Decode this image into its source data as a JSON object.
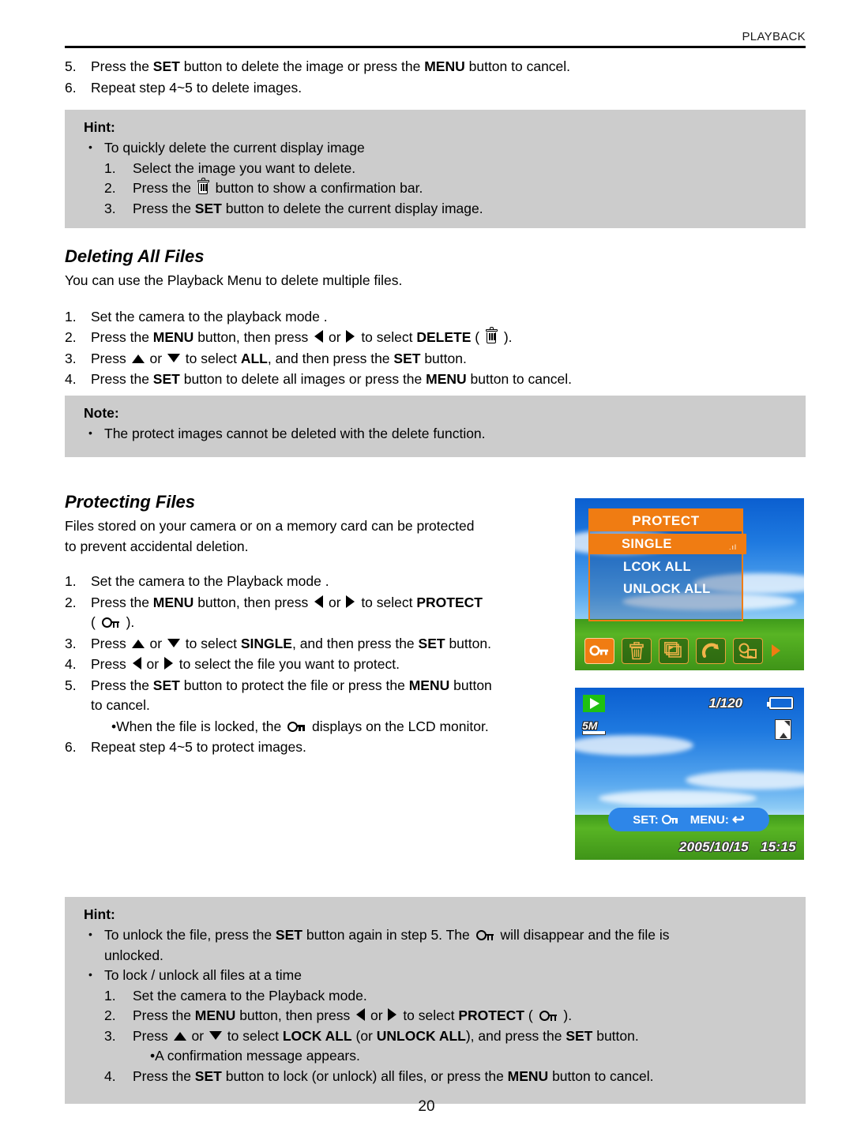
{
  "header": {
    "section_label": "PLAYBACK"
  },
  "delete_steps_continued": [
    {
      "num": "5.",
      "pre": "Press the ",
      "b1": "SET",
      "mid": " button to delete the image or press the ",
      "b2": "MENU",
      "post": " button to cancel."
    },
    {
      "num": "6.",
      "pre": "Repeat step 4~5 to delete images.",
      "b1": "",
      "mid": "",
      "b2": "",
      "post": ""
    }
  ],
  "hint_delete": {
    "title": "Hint:",
    "bullet": "To quickly delete the current display image",
    "steps": [
      {
        "num": "1.",
        "pre": "Select the image you want to delete.",
        "b1": "",
        "post": ""
      },
      {
        "num": "2.",
        "pre": "Press the ",
        "icon": "trash-icon",
        "post": " button to show a confirmation bar."
      },
      {
        "num": "3.",
        "pre": "Press the ",
        "b1": "SET",
        "post": " button to delete the current display image."
      }
    ]
  },
  "deleting_all": {
    "heading": "Deleting All Files",
    "intro": "You can use the Playback Menu to delete multiple files.",
    "steps": [
      {
        "num": "1.",
        "text": "Set the camera to the playback mode ."
      },
      {
        "num": "2.",
        "p1": "Press the ",
        "b1": "MENU",
        "p2": " button, then press ",
        "arrow1": "left-arrow-icon",
        "p3": " or ",
        "arrow2": "right-arrow-icon",
        "p4": " to select ",
        "b2": "DELETE",
        "p5": " ( ",
        "icon": "trash-icon",
        "p6": " )."
      },
      {
        "num": "3.",
        "p1": "Press ",
        "arrow1": "up-arrow-icon",
        "p2": " or ",
        "arrow2": "down-arrow-icon",
        "p3": " to select ",
        "b1": "ALL",
        "p4": ", and then press the ",
        "b2": "SET",
        "p5": " button."
      },
      {
        "num": "4.",
        "p1": "Press the ",
        "b1": "SET",
        "p2": " button to delete all images or press the ",
        "b2": "MENU",
        "p3": " button to cancel."
      }
    ]
  },
  "note_box": {
    "title": "Note:",
    "bullet": "The protect images cannot be deleted with the delete function."
  },
  "protecting": {
    "heading": "Protecting Files",
    "intro_line1": "Files stored on your camera or on a memory card can be protected",
    "intro_line2": "to prevent accidental deletion.",
    "steps": [
      {
        "num": "1.",
        "text": "Set the camera to the Playback mode ."
      },
      {
        "num": "2.",
        "p1": "Press the ",
        "b1": "MENU",
        "p2": " button, then press ",
        "arrow1": "left-arrow-icon",
        "p3": " or ",
        "arrow2": "right-arrow-icon",
        "p4": " to select ",
        "b2": "PROTECT",
        "p5": "( ",
        "icon": "key-icon",
        "p6": " )."
      },
      {
        "num": "3.",
        "p1": "Press ",
        "arrow1": "up-arrow-icon",
        "p2": " or ",
        "arrow2": "down-arrow-icon",
        "p3": " to select ",
        "b1": "SINGLE",
        "p4": ", and then press the ",
        "b2": "SET",
        "p5": " button."
      },
      {
        "num": "4.",
        "p1": "Press ",
        "arrow1": "left-arrow-icon",
        "p2": " or ",
        "arrow2": "right-arrow-icon",
        "p3": " to select the file you want to protect."
      },
      {
        "num": "5.",
        "p1": "Press the ",
        "b1": "SET",
        "p2": " button to protect the file or press the ",
        "b2": "MENU",
        "p3": " button",
        "p4": "to cancel."
      },
      {
        "num": "",
        "bullet": true,
        "p1": "When the file is locked, the ",
        "icon": "key-icon",
        "p2": " displays on the LCD monitor."
      },
      {
        "num": "6.",
        "text": "Repeat step 4~5 to protect images."
      }
    ]
  },
  "camera_menu_screen": {
    "menu_title": "PROTECT",
    "items": [
      {
        "label": "SINGLE",
        "selected": true
      },
      {
        "label": "LCOK ALL",
        "selected": false
      },
      {
        "label": "UNLOCK ALL",
        "selected": false
      }
    ],
    "scroll_marker": ".ıl",
    "toolbar_icons": [
      {
        "name": "protect-key-icon",
        "active": true
      },
      {
        "name": "delete-trash-icon",
        "active": false
      },
      {
        "name": "slideshow-icon",
        "active": false
      },
      {
        "name": "rotate-icon",
        "active": false
      },
      {
        "name": "copy-to-card-icon",
        "active": false
      },
      {
        "name": "next-page-arrow-icon",
        "active": false
      }
    ],
    "colors": {
      "menu_orange": "#f07c12",
      "sky_blue": "#1f7ae0",
      "grass_green": "#58b424"
    }
  },
  "camera_playback_screen": {
    "mode_icon": "play-mode-icon",
    "resolution": "5M",
    "frame_counter": "1/120",
    "battery_icon": "battery-full-icon",
    "card_icon": "sd-card-icon",
    "hint_set_label": "SET:",
    "hint_menu_label": "MENU:",
    "date": "2005/10/15",
    "time": "15:15",
    "colors": {
      "hintbar_blue": "#2e86e8",
      "play_green": "#1fc112"
    }
  },
  "hint_protect": {
    "title": "Hint:",
    "bullets": [
      {
        "p1": "To unlock the file, press the ",
        "b1": "SET",
        "p2": " button again in step 5.  The ",
        "icon": "key-icon",
        "p3": " will disappear and the file is",
        "p4": "unlocked."
      },
      {
        "p1": "To lock / unlock all files at a time"
      }
    ],
    "steps": [
      {
        "num": "1.",
        "text": "Set the camera to the Playback mode."
      },
      {
        "num": "2.",
        "p1": "Press the ",
        "b1": "MENU",
        "p2": " button, then press ",
        "arrow1": "left-arrow-icon",
        "p3": " or ",
        "arrow2": "right-arrow-icon",
        "p4": "  to select ",
        "b2": "PROTECT",
        "p5": " ( ",
        "icon": "key-icon",
        "p6": " )."
      },
      {
        "num": "3.",
        "p1": "Press ",
        "arrow1": "up-arrow-icon",
        "p2": " or ",
        "arrow2": "down-arrow-icon",
        "p3": " to select ",
        "b1": "LOCK ALL",
        "p4": " (or ",
        "b2": "UNLOCK ALL",
        "p5": "), and press the ",
        "b3": "SET",
        "p6": " button."
      },
      {
        "num": "",
        "bullet": true,
        "text": "A confirmation message appears."
      },
      {
        "num": "4.",
        "p1": "Press the ",
        "b1": "SET",
        "p2": " button to lock (or unlock) all files, or press the ",
        "b2": "MENU",
        "p3": " button to cancel."
      }
    ]
  },
  "footer": {
    "page_number": "20"
  }
}
